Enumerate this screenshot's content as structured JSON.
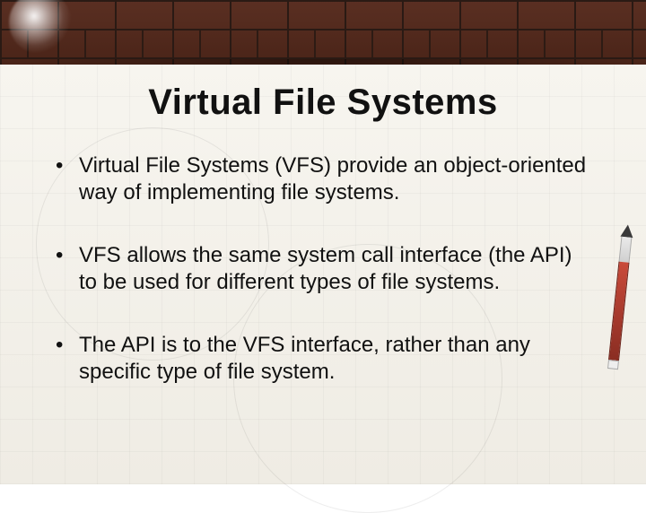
{
  "slide": {
    "title": "Virtual File Systems",
    "bullets": [
      "Virtual File Systems (VFS) provide an object-oriented way of implementing file systems.",
      "VFS allows the same system call interface (the API) to be used for different types of file systems.",
      "The API is to the VFS interface, rather than any specific type of file system."
    ]
  }
}
